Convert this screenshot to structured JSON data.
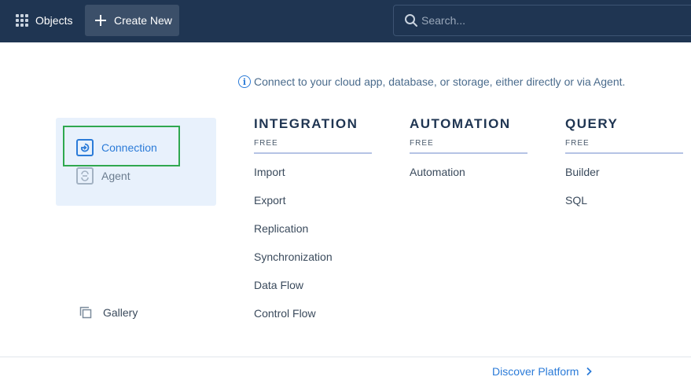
{
  "topbar": {
    "objects_label": "Objects",
    "create_label": "Create New",
    "search_placeholder": "Search..."
  },
  "info": {
    "icon": "info-icon",
    "text": "Connect to your cloud app, database, or storage, either directly or via Agent."
  },
  "left_panel": {
    "items": [
      {
        "label": "Connection",
        "icon": "connection-icon",
        "selected": true
      },
      {
        "label": "Agent",
        "icon": "agent-icon",
        "selected": false
      }
    ],
    "gallery_label": "Gallery"
  },
  "columns": [
    {
      "title": "INTEGRATION",
      "subtitle": "FREE",
      "items": [
        "Import",
        "Export",
        "Replication",
        "Synchronization",
        "Data Flow",
        "Control Flow"
      ]
    },
    {
      "title": "AUTOMATION",
      "subtitle": "FREE",
      "items": [
        "Automation"
      ]
    },
    {
      "title": "QUERY",
      "subtitle": "FREE",
      "items": [
        "Builder",
        "SQL"
      ]
    }
  ],
  "footer": {
    "discover_label": "Discover Platform"
  },
  "colors": {
    "topbar": "#1f3552",
    "accent": "#2b7bd8",
    "panel_bg": "#e8f1fc",
    "highlight": "#2fa84f"
  }
}
